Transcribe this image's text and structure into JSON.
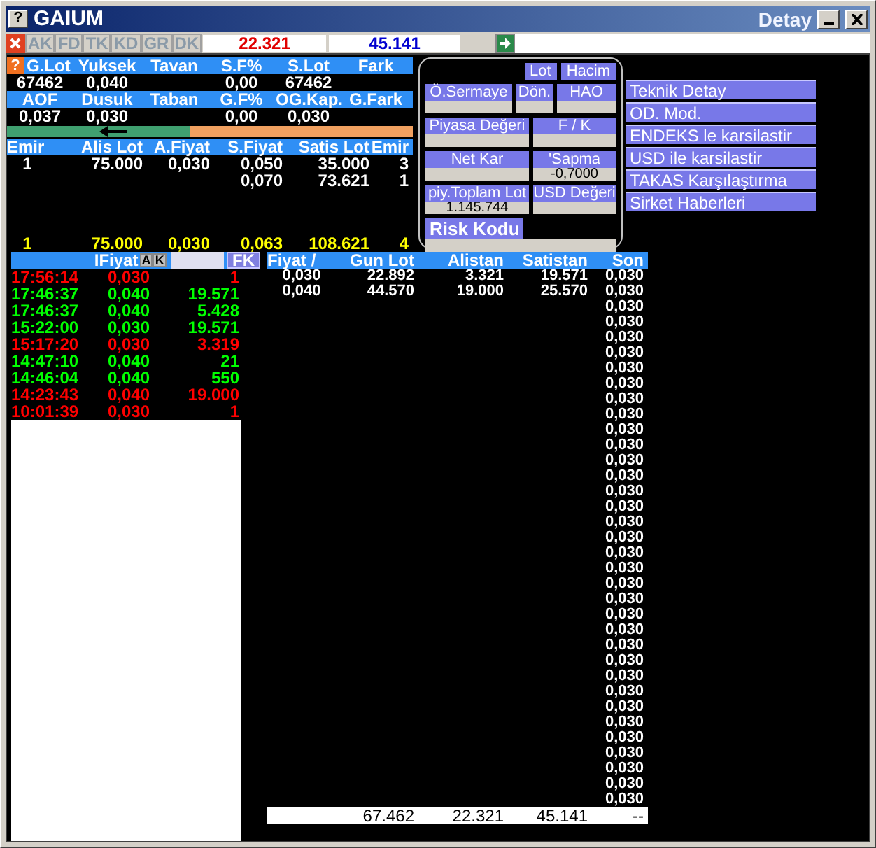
{
  "window": {
    "help": "?",
    "title": "GAIUM",
    "caption": "Detay"
  },
  "toolbar": {
    "tabs": [
      {
        "label": "AK",
        "disabled": true
      },
      {
        "label": "FD",
        "disabled": true
      },
      {
        "label": "TK",
        "disabled": true
      },
      {
        "label": "KD",
        "disabled": true
      },
      {
        "label": "GR",
        "disabled": true
      },
      {
        "label": "DK",
        "disabled": true
      }
    ],
    "bid_total": "22.321",
    "ask_total": "45.141"
  },
  "summary": {
    "help": "?",
    "rows": [
      {
        "cells": [
          {
            "header": "G.Lot",
            "value": "67462"
          },
          {
            "header": "Yuksek",
            "value": "0,040"
          },
          {
            "header": "Tavan"
          },
          {
            "header": "S.F%",
            "value": "0,00"
          },
          {
            "header": "S.Lot",
            "value": "67462"
          },
          {
            "header": "Fark"
          }
        ]
      },
      {
        "cells": [
          {
            "header": "AOF",
            "value": "0,037"
          },
          {
            "header": "Dusuk",
            "value": "0,030"
          },
          {
            "header": "Taban"
          },
          {
            "header": "G.F%",
            "value": "0,00"
          },
          {
            "header": "OG.Kap.",
            "value": "0,030"
          },
          {
            "header": "G.Fark"
          }
        ]
      }
    ]
  },
  "balance_bar": {
    "level": 0.45
  },
  "order_book": {
    "columns": [
      "Emir",
      "Alis Lot",
      "A.Fiyat",
      "S.Fiyat",
      "Satis Lot",
      "Emir"
    ],
    "rows": [
      {
        "buy_orders": "1",
        "buy_lot": "75.000",
        "bid": "0,030",
        "ask": "0,050",
        "sell_lot": "35.000",
        "sell_orders": "3"
      },
      {
        "ask": "0,070",
        "sell_lot": "73.621",
        "sell_orders": "1"
      }
    ],
    "totals": {
      "buy_orders": "1",
      "buy_lot": "75.000",
      "bid": "0,030",
      "ask": "0,063",
      "sell_lot": "108.621",
      "sell_orders": "4"
    }
  },
  "details_panel": {
    "buttons": [
      "Lot",
      "Hacim"
    ],
    "rows": [
      [
        {
          "label": "Ö.Sermaye",
          "kind": "normal"
        },
        {
          "label": "Dön.",
          "kind": "normal"
        },
        {
          "label": "HAO",
          "kind": "normal"
        }
      ],
      [
        {
          "label": "Piyasa Değeri",
          "kind": "normal"
        },
        {
          "label": "F / K",
          "kind": "normal"
        }
      ],
      [
        {
          "label": "Net Kar",
          "kind": "normal"
        },
        {
          "label": "'Sapma",
          "kind": "normal",
          "value": "-0,7000"
        }
      ],
      [
        {
          "label": "piy.Toplam Lot",
          "kind": "normal",
          "value": "1.145.744"
        },
        {
          "label": "USD Değeri",
          "kind": "normal"
        }
      ],
      [
        {
          "label": "Risk Kodu",
          "kind": "strong"
        }
      ]
    ]
  },
  "menu": [
    "Teknik Detay",
    "OD. Mod.",
    "ENDEKS le karsilastir",
    "USD ile karsilastir",
    "TAKAS Karşılaştırma",
    "Sirket Haberleri"
  ],
  "trades": {
    "price_header": "IFiyat",
    "buttons": [
      "A",
      "K"
    ],
    "filter": "FK",
    "rows": [
      {
        "time": "17:56:14",
        "price": "0,030",
        "lot": "1",
        "color": "#ff0000"
      },
      {
        "time": "17:46:37",
        "price": "0,040",
        "lot": "19.571",
        "color": "#00ff00"
      },
      {
        "time": "17:46:37",
        "price": "0,040",
        "lot": "5.428",
        "color": "#00ff00"
      },
      {
        "time": "15:22:00",
        "price": "0,030",
        "lot": "19.571",
        "color": "#00ff00"
      },
      {
        "time": "15:17:20",
        "price": "0,030",
        "lot": "3.319",
        "color": "#ff0000"
      },
      {
        "time": "14:47:10",
        "price": "0,040",
        "lot": "21",
        "color": "#00ff00"
      },
      {
        "time": "14:46:04",
        "price": "0,040",
        "lot": "550",
        "color": "#00ff00"
      },
      {
        "time": "14:23:43",
        "price": "0,040",
        "lot": "19.000",
        "color": "#ff0000"
      },
      {
        "time": "10:01:39",
        "price": "0,030",
        "lot": "1",
        "color": "#ff0000"
      }
    ]
  },
  "table": {
    "columns": [
      "Fiyat /",
      "Gun Lot",
      "Alistan",
      "Satistan",
      "Son"
    ],
    "rows": [
      {
        "price": "0,030",
        "day_lot": "22.892",
        "bought": "3.321",
        "sold": "19.571",
        "last": "0,030"
      },
      {
        "price": "0,040",
        "day_lot": "44.570",
        "bought": "19.000",
        "sold": "25.570",
        "last": "0,030"
      },
      {
        "last": "0,030"
      },
      {
        "last": "0,030"
      },
      {
        "last": "0,030"
      },
      {
        "last": "0,030"
      },
      {
        "last": "0,030"
      },
      {
        "last": "0,030"
      },
      {
        "last": "0,030"
      },
      {
        "last": "0,030"
      },
      {
        "last": "0,030"
      },
      {
        "last": "0,030"
      },
      {
        "last": "0,030"
      },
      {
        "last": "0,030"
      },
      {
        "last": "0,030"
      },
      {
        "last": "0,030"
      },
      {
        "last": "0,030"
      },
      {
        "last": "0,030"
      },
      {
        "last": "0,030"
      },
      {
        "last": "0,030"
      },
      {
        "last": "0,030"
      },
      {
        "last": "0,030"
      },
      {
        "last": "0,030"
      },
      {
        "last": "0,030"
      },
      {
        "last": "0,030"
      },
      {
        "last": "0,030"
      },
      {
        "last": "0,030"
      },
      {
        "last": "0,030"
      },
      {
        "last": "0,030"
      },
      {
        "last": "0,030"
      },
      {
        "last": "0,030"
      },
      {
        "last": "0,030"
      },
      {
        "last": "0,030"
      },
      {
        "last": "0,030"
      },
      {
        "last": "0,030"
      }
    ],
    "totals": {
      "day_lot": "67.462",
      "bought": "22.321",
      "sold": "45.141",
      "last": "--"
    }
  }
}
